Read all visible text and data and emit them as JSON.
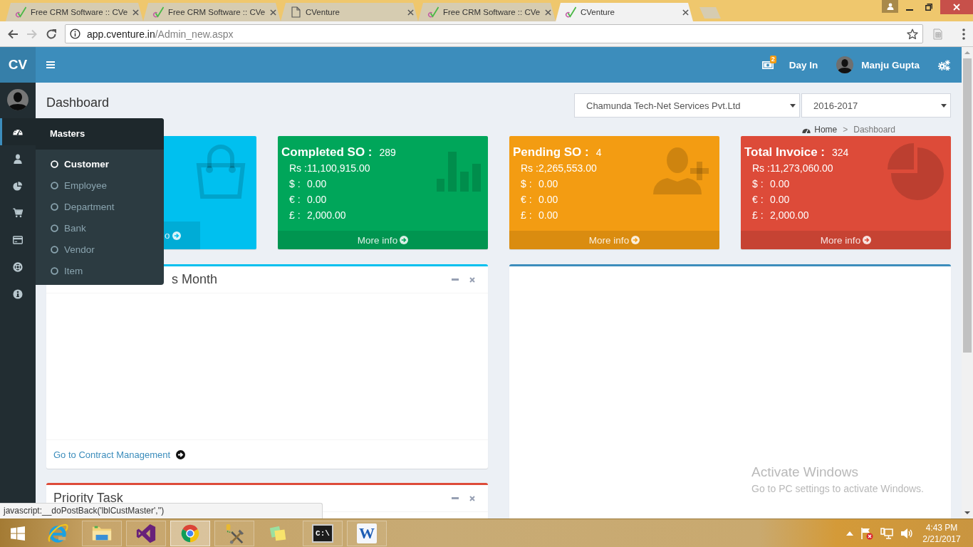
{
  "browser": {
    "tabs": [
      {
        "title": "Free CRM Software :: CVe",
        "kind": "site",
        "selected": false
      },
      {
        "title": "Free CRM Software :: CVe",
        "kind": "site",
        "selected": false
      },
      {
        "title": "CVenture",
        "kind": "page",
        "selected": false
      },
      {
        "title": "Free CRM Software :: CVe",
        "kind": "site",
        "selected": false
      },
      {
        "title": "CVenture",
        "kind": "site",
        "selected": true
      }
    ],
    "address": {
      "host": "app.cventure.in",
      "path": "/Admin_new.aspx"
    },
    "status_url": "javascript:__doPostBack('lblCustMaster','')"
  },
  "header": {
    "logo": "CV",
    "badge": "2",
    "day_in": "Day In",
    "user": "Manju Gupta"
  },
  "sidebar": {
    "items": [
      {
        "selected": true
      },
      {
        "selected": false
      },
      {
        "selected": false
      },
      {
        "selected": false
      },
      {
        "selected": false
      },
      {
        "selected": false
      },
      {
        "selected": false
      }
    ]
  },
  "flyout": {
    "title": "Masters",
    "items": [
      {
        "label": "Customer",
        "selected": true
      },
      {
        "label": "Employee",
        "selected": false
      },
      {
        "label": "Department",
        "selected": false
      },
      {
        "label": "Bank",
        "selected": false
      },
      {
        "label": "Vendor",
        "selected": false
      },
      {
        "label": "Item",
        "selected": false
      }
    ]
  },
  "page": {
    "title": "Dashboard",
    "company": "Chamunda Tech-Net Services Pvt.Ltd",
    "year": "2016-2017",
    "breadcrumb": {
      "home": "Home",
      "separator": ">",
      "current": "Dashboard"
    }
  },
  "cards": [
    {
      "color": "#00c0ef",
      "footer": "o"
    },
    {
      "color": "#00a65a",
      "title": "Completed SO :",
      "count": "289",
      "lines": [
        {
          "label": "Rs :",
          "value": "11,100,915.00"
        },
        {
          "label": "$ :",
          "value": "0.00"
        },
        {
          "label": "€ :",
          "value": "0.00"
        },
        {
          "label": "£ :",
          "value": "2,000.00"
        }
      ],
      "footer": "More info"
    },
    {
      "color": "#f39c12",
      "title": "Pending SO :",
      "count": "4",
      "lines": [
        {
          "label": "Rs :",
          "value": "2,265,553.00"
        },
        {
          "label": "$ :",
          "value": "0.00"
        },
        {
          "label": "€ :",
          "value": "0.00"
        },
        {
          "label": "£ :",
          "value": "0.00"
        }
      ],
      "footer": "More info"
    },
    {
      "color": "#dd4b39",
      "title": "Total Invoice :",
      "count": "324",
      "lines": [
        {
          "label": "Rs :",
          "value": "11,273,060.00"
        },
        {
          "label": "$ :",
          "value": "0.00"
        },
        {
          "label": "€ :",
          "value": "0.00"
        },
        {
          "label": "£ :",
          "value": "2,000.00"
        }
      ],
      "footer": "More info"
    }
  ],
  "boxes": [
    {
      "color": "#00c0ef",
      "title": "s Month",
      "link": "Go to Contract Management"
    },
    {
      "color": "#3c8dbc"
    },
    {
      "color": "#dd4b39",
      "title": "Priority Task"
    }
  ],
  "activation": {
    "title": "Activate Windows",
    "text": "Go to PC settings to activate Windows."
  },
  "taskbar": {
    "apps": [
      {
        "selected": false,
        "running": false
      },
      {
        "selected": false,
        "running": true
      },
      {
        "selected": false,
        "running": true
      },
      {
        "selected": true,
        "running": true
      },
      {
        "selected": false,
        "running": true
      },
      {
        "selected": false,
        "running": false
      },
      {
        "selected": false,
        "running": true,
        "text": "C:\\"
      },
      {
        "selected": false,
        "running": true,
        "text": "W"
      }
    ],
    "time": "4:43 PM",
    "date": "2/21/2017"
  }
}
